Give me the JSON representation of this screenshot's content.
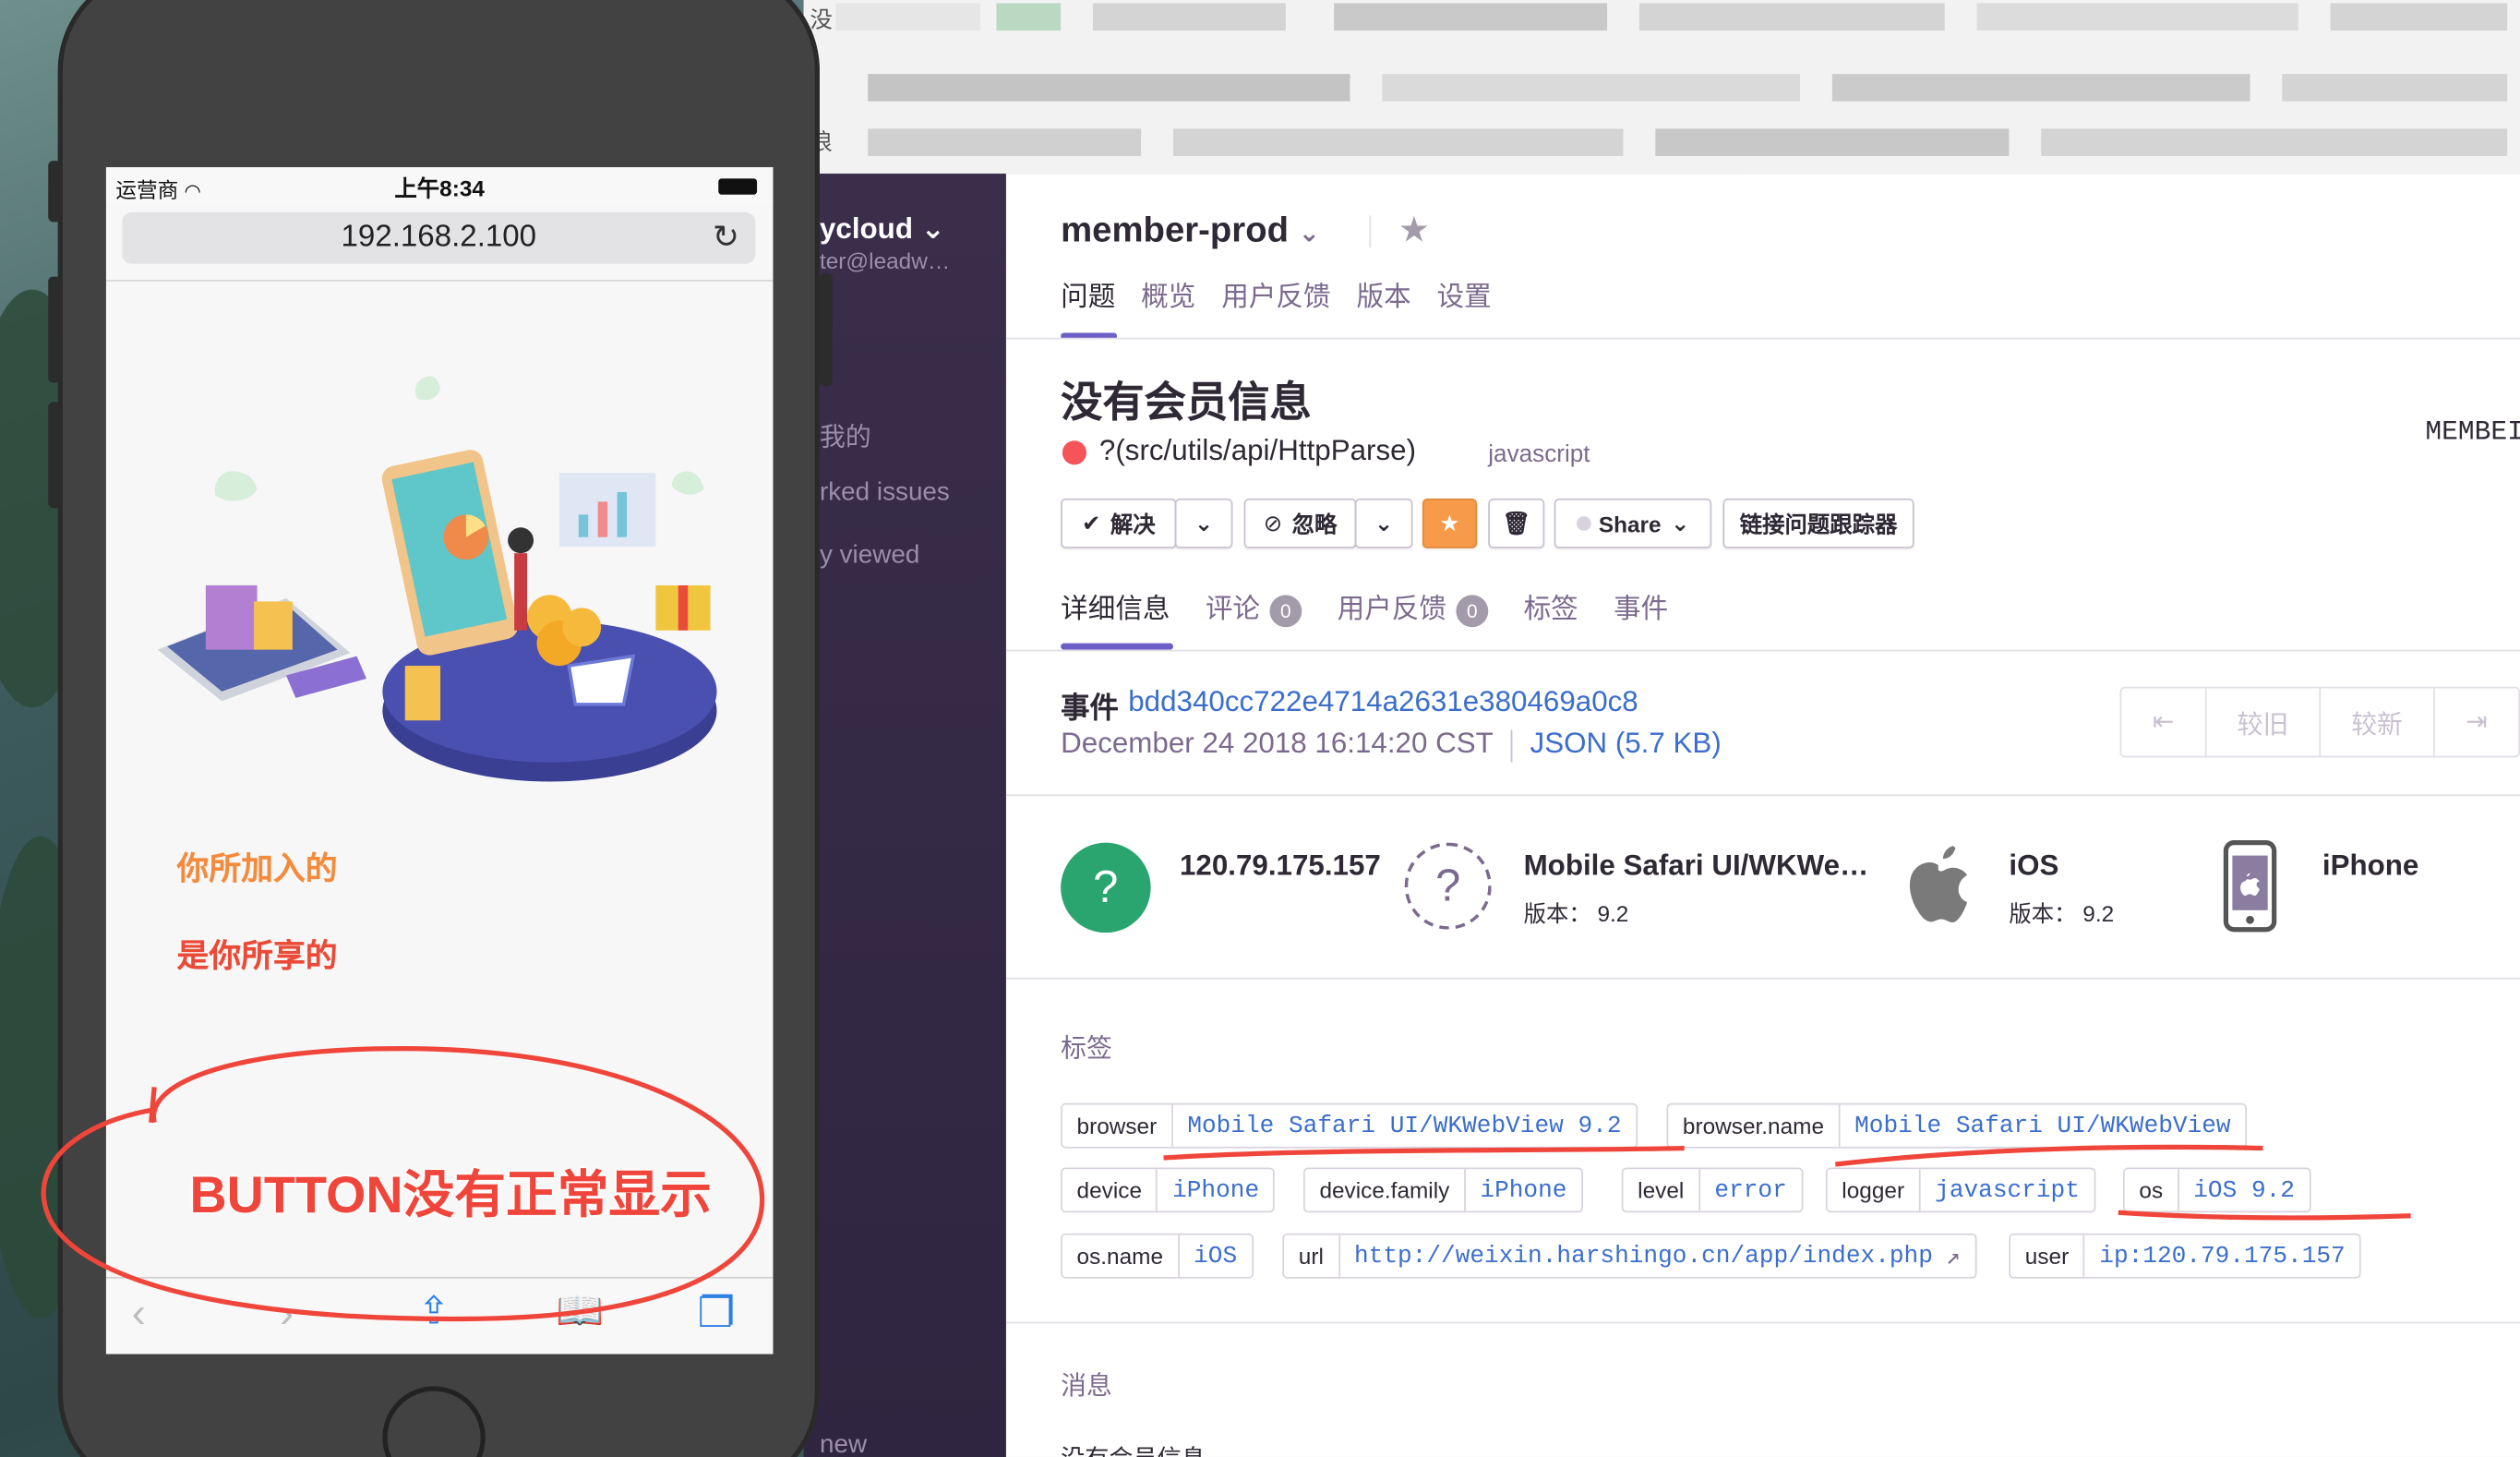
{
  "browser_blur": {
    "top_char_1": "没",
    "top_char_2": "浪"
  },
  "sidebar": {
    "org": "ycloud ⌄",
    "email": "ter@leadw…",
    "items": [
      "我的",
      "rked issues",
      "y viewed",
      "new"
    ]
  },
  "sentry": {
    "project": "member-prod",
    "project_caret": "⌄",
    "nav_tabs": [
      "问题",
      "概览",
      "用户反馈",
      "版本",
      "设置"
    ],
    "issue_title": "没有会员信息",
    "culprit": "?(src/utils/api/HttpParse)",
    "platform": "javascript",
    "right_cutoff": "MEMBEI",
    "actions": {
      "resolve": "解决",
      "ignore": "忽略",
      "share": "Share",
      "link_tracker": "链接问题跟踪器"
    },
    "detail_tabs": [
      {
        "label": "详细信息",
        "count": ""
      },
      {
        "label": "评论",
        "count": "0"
      },
      {
        "label": "用户反馈",
        "count": "0"
      },
      {
        "label": "标签",
        "count": ""
      },
      {
        "label": "事件",
        "count": ""
      }
    ],
    "event": {
      "label": "事件",
      "id": "bdd340cc722e4714a2631e380469a0c8",
      "date": "December 24 2018 16:14:20 CST",
      "json": "JSON (5.7 KB)"
    },
    "pager": [
      "⇤",
      "较旧",
      "较新",
      "⇥"
    ],
    "contexts": {
      "user": {
        "title": "120.79.175.157",
        "icon": "?"
      },
      "browser": {
        "title": "Mobile Safari UI/WKWe…",
        "version_label": "版本：",
        "version": "9.2"
      },
      "os": {
        "title": "iOS",
        "version_label": "版本：",
        "version": "9.2"
      },
      "device": {
        "title": "iPhone"
      }
    },
    "tags_heading": "标签",
    "tags": [
      {
        "key": "browser",
        "value": "Mobile Safari UI/WKWebView 9.2"
      },
      {
        "key": "browser.name",
        "value": "Mobile Safari UI/WKWebView"
      },
      {
        "key": "device",
        "value": "iPhone"
      },
      {
        "key": "device.family",
        "value": "iPhone"
      },
      {
        "key": "level",
        "value": "error"
      },
      {
        "key": "logger",
        "value": "javascript"
      },
      {
        "key": "os",
        "value": "iOS 9.2"
      },
      {
        "key": "os.name",
        "value": "iOS"
      },
      {
        "key": "url",
        "value": "http://weixin.harshingo.cn/app/index.php"
      },
      {
        "key": "user",
        "value": "ip:120.79.175.157"
      }
    ],
    "message_heading": "消息",
    "message_body": "没有会员信息"
  },
  "phone": {
    "carrier": "运营商 ",
    "time": "上午8:34",
    "url": "192.168.2.100",
    "slogan_line1": "你所加入的",
    "slogan_line2": "是你所享的",
    "annotation": "BUTTON没有正常显示"
  },
  "colors": {
    "accent": "#6c5fc7",
    "link": "#3b6ecc",
    "error": "#f55459",
    "annotation": "#f0453a"
  }
}
